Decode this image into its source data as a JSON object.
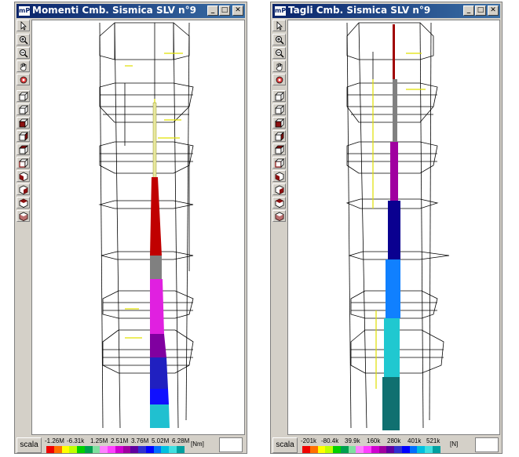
{
  "windows": [
    {
      "id": "moments",
      "title": "Momenti Cmb. Sismica SLV n°9",
      "app_icon_label": "mP",
      "scale_button": "scala",
      "scale_ticks": [
        "-1.26M",
        "-6.31k",
        "1.25M",
        "2.51M",
        "3.76M",
        "5.02M",
        "6.28M"
      ],
      "unit": "[Nm]",
      "colorbar": [
        "#f00000",
        "#ff7000",
        "#ffff00",
        "#c0ff00",
        "#00d000",
        "#00a050",
        "#80e0a0",
        "#ff80ff",
        "#ff40ff",
        "#d000d0",
        "#a000a0",
        "#6000a0",
        "#3030d0",
        "#0000ff",
        "#0070ff",
        "#00c0e0",
        "#40e0e0",
        "#00a0a0"
      ]
    },
    {
      "id": "shear",
      "title": "Tagli Cmb. Sismica SLV n°9",
      "app_icon_label": "mP",
      "scale_button": "scala",
      "scale_ticks": [
        "-201k",
        "-80.4k",
        "39.9k",
        "160k",
        "280k",
        "401k",
        "521k"
      ],
      "unit": "[N]",
      "colorbar": [
        "#f00000",
        "#ff7000",
        "#ffff00",
        "#c0ff00",
        "#00d000",
        "#00a050",
        "#80e0a0",
        "#ff80ff",
        "#ff40ff",
        "#d000d0",
        "#a000a0",
        "#6000a0",
        "#3030d0",
        "#0000ff",
        "#0070ff",
        "#00c0e0",
        "#40e0e0",
        "#00a0a0"
      ]
    }
  ],
  "window_buttons": [
    "_",
    "□",
    "✕"
  ],
  "toolbar_icons": [
    "pointer-icon",
    "zoom-in-icon",
    "zoom-out-icon",
    "pan-hand-icon",
    "rotate-icon",
    "view-front-icon",
    "view-back-icon",
    "view-left-icon",
    "view-right-icon",
    "view-top-icon",
    "view-bottom-icon",
    "iso-view-1-icon",
    "iso-view-2-icon",
    "iso-view-3-icon",
    "iso-view-4-icon"
  ]
}
